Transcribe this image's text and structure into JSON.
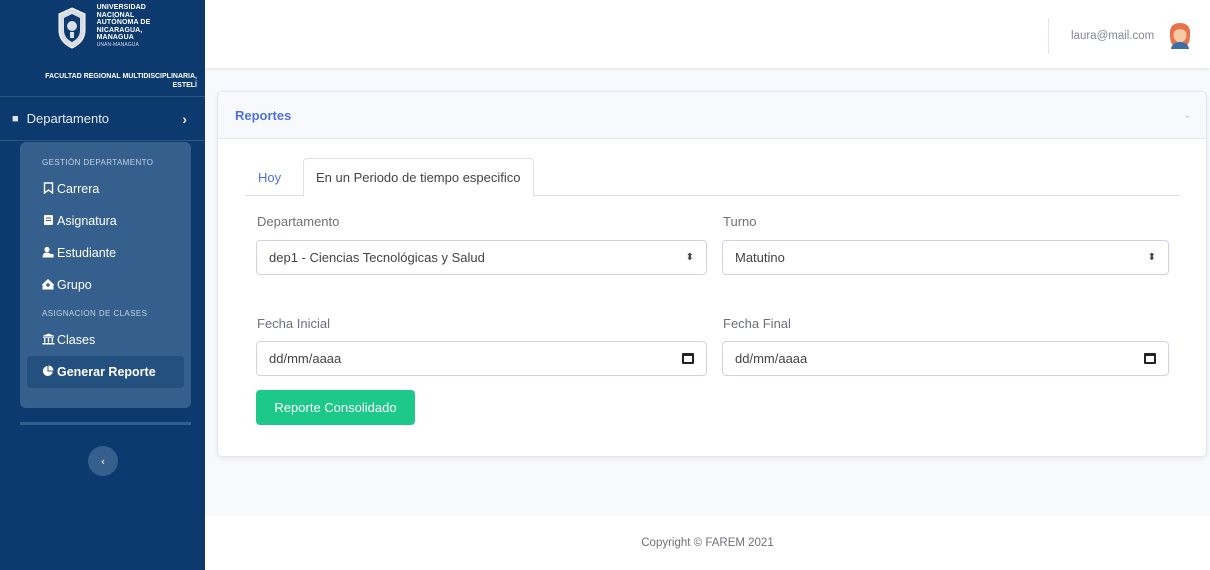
{
  "brand": {
    "university_lines": [
      "UNIVERSIDAD",
      "NACIONAL",
      "AUTÓNOMA DE",
      "NICARAGUA,",
      "MANAGUA"
    ],
    "university_sub": "UNAN-MANAGUA",
    "faculty_line1": "FACULTAD REGIONAL MULTIDISCIPLINARIA,",
    "faculty_line2": "ESTELÍ"
  },
  "sidebar": {
    "department_label": "Departamento",
    "section_gestion": "GESTIÓN DEPARTAMENTO",
    "items_gestion": [
      {
        "label": "Carrera",
        "icon": "bookmark-icon"
      },
      {
        "label": "Asignatura",
        "icon": "book-icon"
      },
      {
        "label": "Estudiante",
        "icon": "user-icon"
      },
      {
        "label": "Grupo",
        "icon": "group-icon"
      }
    ],
    "section_asignacion": "ASIGNACION DE CLASES",
    "items_asignacion": [
      {
        "label": "Clases",
        "icon": "university-icon"
      },
      {
        "label": "Generar Reporte",
        "icon": "pie-chart-icon",
        "active": true
      }
    ]
  },
  "topbar": {
    "user_email": "laura@mail.com"
  },
  "card": {
    "title": "Reportes",
    "tabs": [
      {
        "label": "Hoy"
      },
      {
        "label": "En un Periodo de tiempo especifico",
        "active": true
      }
    ],
    "form": {
      "departamento_label": "Departamento",
      "departamento_value": "dep1 - Ciencias Tecnológicas y Salud",
      "turno_label": "Turno",
      "turno_value": "Matutino",
      "fecha_inicial_label": "Fecha Inicial",
      "fecha_inicial_placeholder": "dd/mm/aaaa",
      "fecha_final_label": "Fecha Final",
      "fecha_final_placeholder": "dd/mm/aaaa"
    },
    "button_label": "Reporte Consolidado"
  },
  "footer": {
    "copyright": "Copyright © FAREM 2021"
  },
  "colors": {
    "sidebar_bg": "#0c3a6e",
    "primary": "#4e73df",
    "success": "#1cc88a"
  }
}
